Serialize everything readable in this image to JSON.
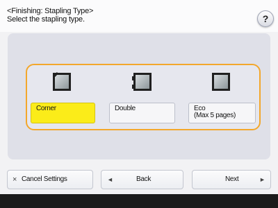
{
  "header": {
    "title_line1": "<Finishing: Stapling Type>",
    "title_line2": "Select the stapling type.",
    "help_label": "?"
  },
  "options": [
    {
      "label_line1": "Corner",
      "label_line2": "",
      "selected": true,
      "icon": "staple-corner-icon"
    },
    {
      "label_line1": "Double",
      "label_line2": "",
      "selected": false,
      "icon": "staple-double-icon"
    },
    {
      "label_line1": "Eco",
      "label_line2": "(Max 5 pages)",
      "selected": false,
      "icon": "staple-eco-icon"
    }
  ],
  "buttons": {
    "cancel_label": "Cancel Settings",
    "cancel_icon": "×",
    "back_label": "Back",
    "back_icon": "◄",
    "next_label": "Next",
    "next_icon": "►"
  },
  "colors": {
    "selection_outline": "#f3a72b",
    "selected_option": "#fbec19",
    "footer_bar": "#1b1b1b"
  }
}
